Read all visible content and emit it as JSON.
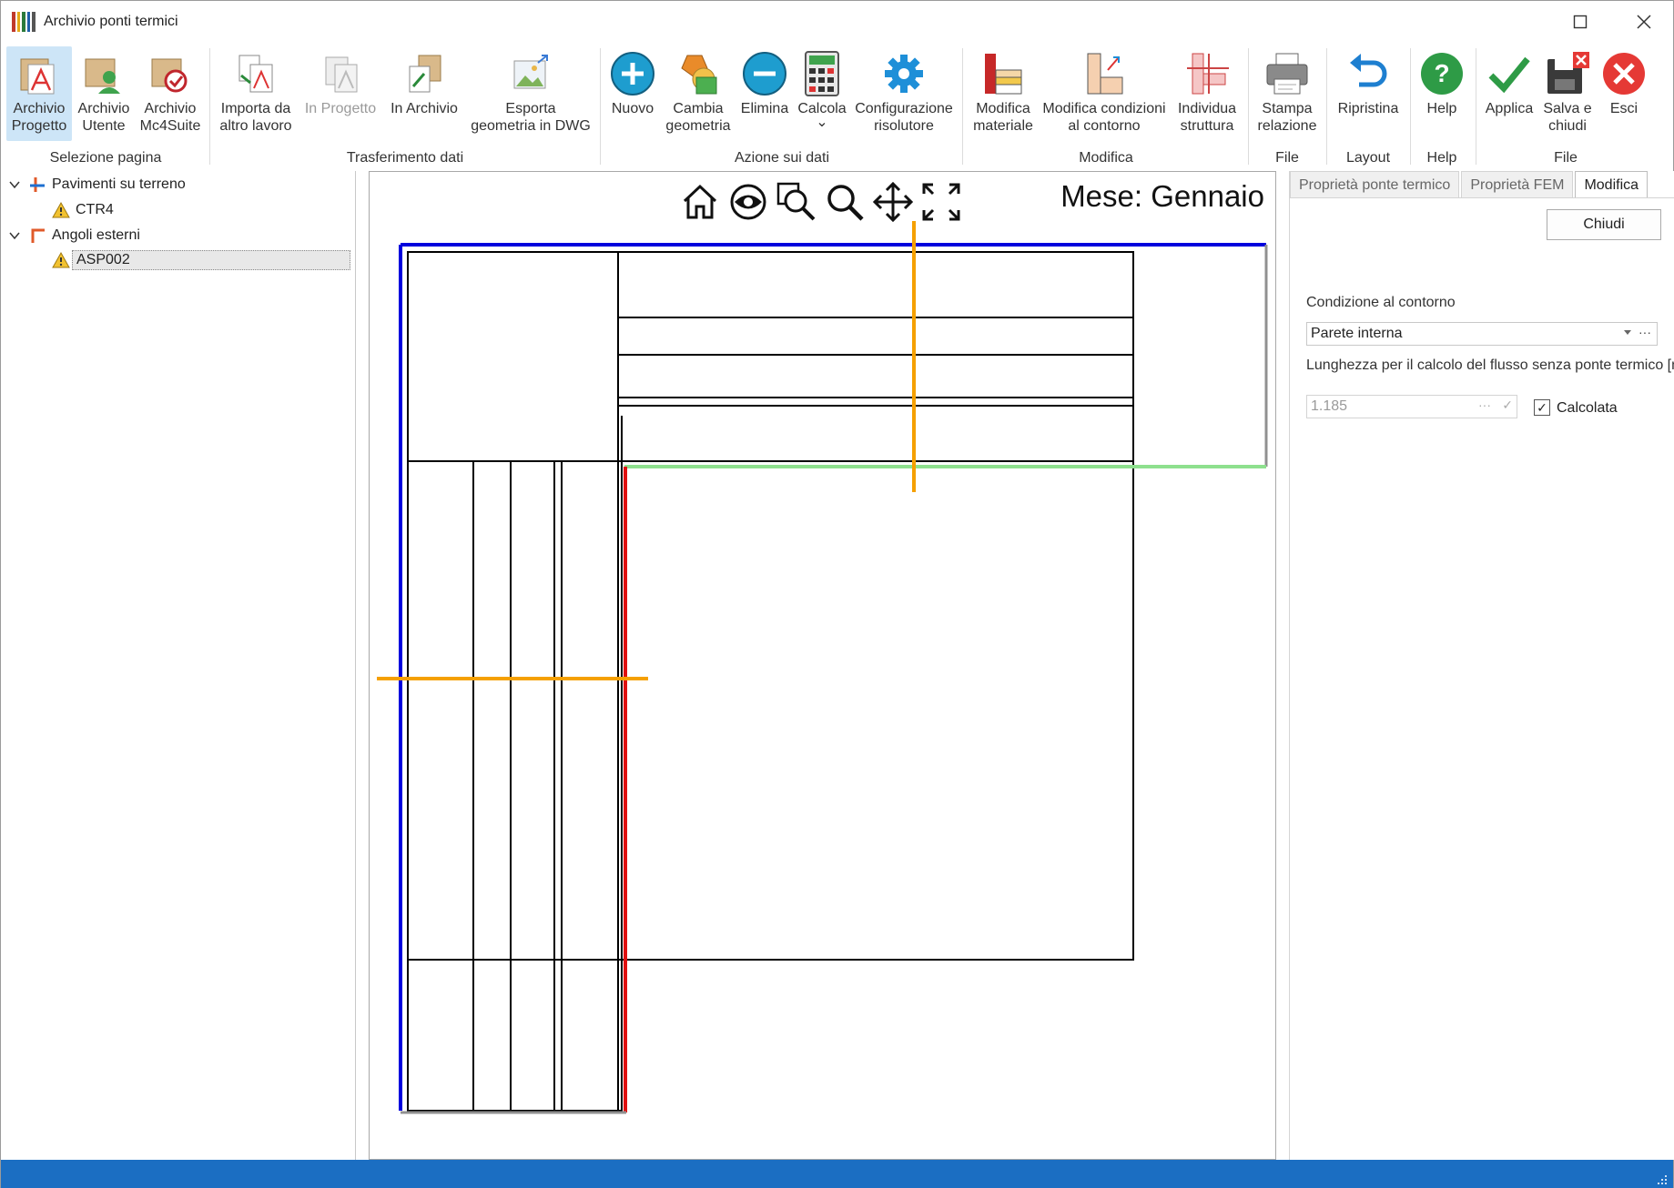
{
  "window": {
    "title": "Archivio ponti termici",
    "controls": {
      "maximize": "□",
      "close": "✕"
    }
  },
  "ribbon": {
    "buttons": [
      {
        "id": "archivio-progetto",
        "label1": "Archivio",
        "label2": "Progetto",
        "icon": "folder-project-icon"
      },
      {
        "id": "archivio-utente",
        "label1": "Archivio",
        "label2": "Utente",
        "icon": "folder-user-icon"
      },
      {
        "id": "archivio-mc4suite",
        "label1": "Archivio",
        "label2": "Mc4Suite",
        "icon": "folder-mc4-icon"
      },
      {
        "id": "importa",
        "label1": "Importa da",
        "label2": "altro lavoro",
        "icon": "import-icon"
      },
      {
        "id": "in-progetto",
        "label1": "In Progetto",
        "label2": "",
        "icon": "to-project-icon"
      },
      {
        "id": "in-archivio",
        "label1": "In Archivio",
        "label2": "",
        "icon": "to-archive-icon"
      },
      {
        "id": "esporta",
        "label1": "Esporta",
        "label2": "geometria in DWG",
        "icon": "export-dwg-icon"
      },
      {
        "id": "nuovo",
        "label1": "Nuovo",
        "label2": "",
        "icon": "plus-circle-icon"
      },
      {
        "id": "cambia",
        "label1": "Cambia",
        "label2": "geometria",
        "icon": "shapes-icon"
      },
      {
        "id": "elimina",
        "label1": "Elimina",
        "label2": "",
        "icon": "minus-circle-icon"
      },
      {
        "id": "calcola",
        "label1": "Calcola",
        "label2": "⌄",
        "icon": "calculator-icon"
      },
      {
        "id": "config",
        "label1": "Configurazione",
        "label2": "risolutore",
        "icon": "gear-icon"
      },
      {
        "id": "mod-materiale",
        "label1": "Modifica",
        "label2": "materiale",
        "icon": "material-icon"
      },
      {
        "id": "mod-condizioni",
        "label1": "Modifica condizioni",
        "label2": "al contorno",
        "icon": "boundary-icon"
      },
      {
        "id": "individua",
        "label1": "Individua",
        "label2": "struttura",
        "icon": "structure-icon"
      },
      {
        "id": "stampa",
        "label1": "Stampa",
        "label2": "relazione",
        "icon": "printer-icon"
      },
      {
        "id": "ripristina",
        "label1": "Ripristina",
        "label2": "",
        "icon": "undo-icon"
      },
      {
        "id": "help",
        "label1": "Help",
        "label2": "",
        "icon": "help-icon"
      },
      {
        "id": "applica",
        "label1": "Applica",
        "label2": "",
        "icon": "checkmark-icon"
      },
      {
        "id": "salva",
        "label1": "Salva e",
        "label2": "chiudi",
        "icon": "save-close-icon"
      },
      {
        "id": "esci",
        "label1": "Esci",
        "label2": "",
        "icon": "exit-icon"
      }
    ],
    "groups": [
      "Selezione pagina",
      "Trasferimento dati",
      "Azione sui dati",
      "Modifica",
      "File",
      "Layout",
      "Help",
      "File"
    ]
  },
  "tree": {
    "items": [
      {
        "label": "Pavimenti su terreno",
        "level": 0
      },
      {
        "label": "CTR4",
        "level": 1
      },
      {
        "label": "Angoli esterni",
        "level": 0
      },
      {
        "label": "ASP002",
        "level": 1
      }
    ]
  },
  "canvas": {
    "month_label": "Mese: Gennaio",
    "tools": [
      "home-icon",
      "eye-icon",
      "zoom-window-icon",
      "zoom-icon",
      "pan-icon",
      "fit-icon"
    ]
  },
  "panel": {
    "tabs": [
      "Proprietà ponte termico",
      "Proprietà FEM",
      "Modifica"
    ],
    "close_label": "Chiudi",
    "condition_label": "Condizione al contorno",
    "condition_value": "Parete interna",
    "length_label": "Lunghezza per il calcolo del flusso senza ponte termico [m]",
    "length_value": "1.185",
    "calculated_label": "Calcolata",
    "calculated_checked": "✓"
  },
  "colors": {
    "accent": "#1b6ec2",
    "boundary_external": "#0000dd",
    "boundary_internal": "#e01010",
    "boundary_adiabatic": "#909090",
    "boundary_other": "#8ee08e",
    "section_line": "#f5a000"
  }
}
